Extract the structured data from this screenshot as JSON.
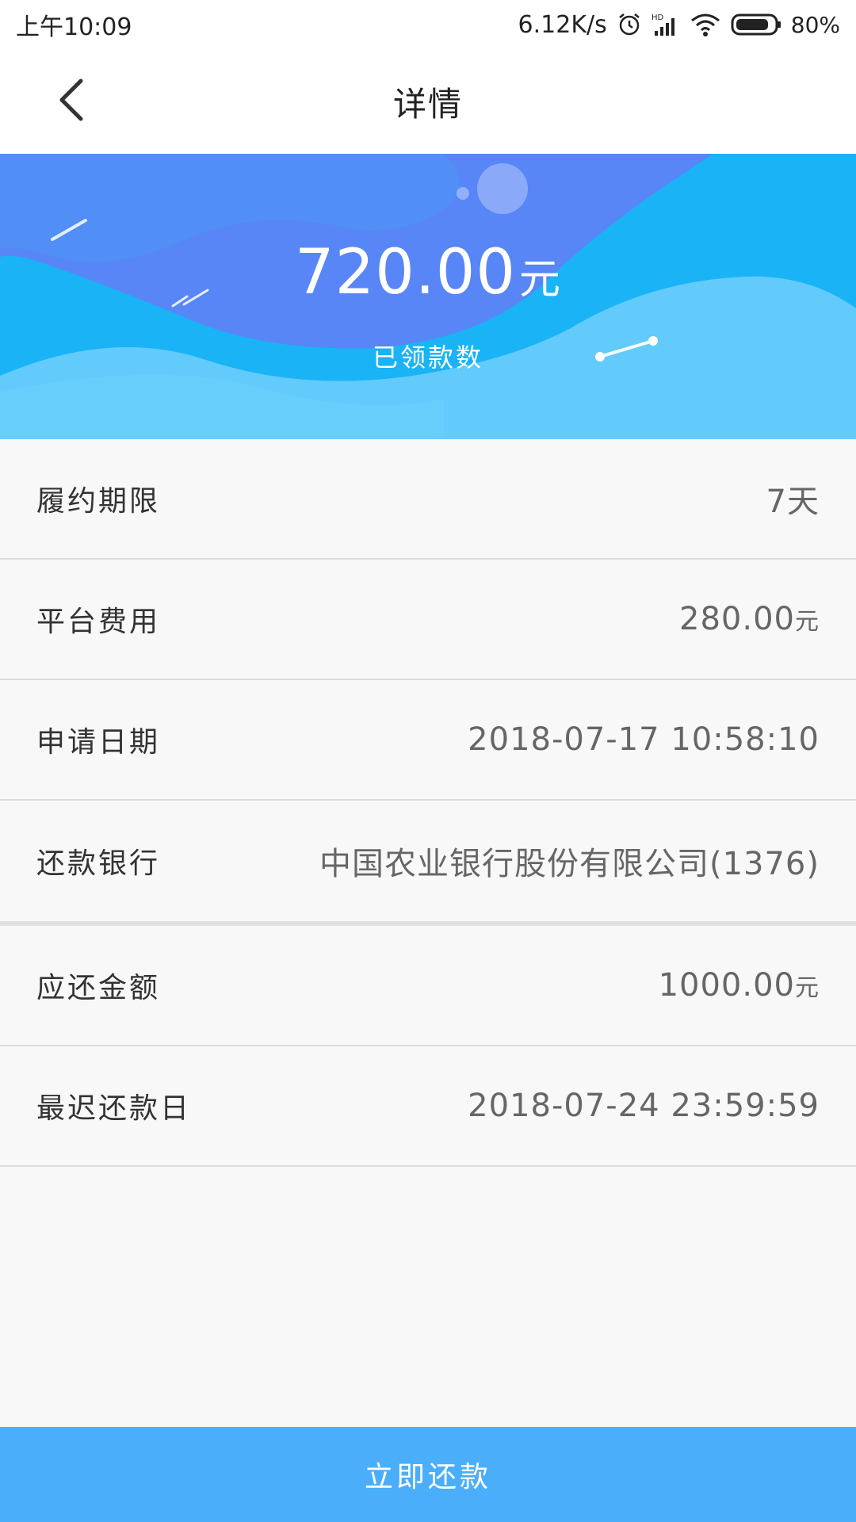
{
  "status_bar": {
    "time": "上午10:09",
    "net_speed": "6.12K/s",
    "battery": "80%",
    "icons": [
      "alarm-icon",
      "hd-signal-icon",
      "wifi-icon",
      "battery-icon"
    ]
  },
  "header": {
    "title": "详情",
    "back_icon": "chevron-left-icon"
  },
  "banner": {
    "amount": "720.00",
    "amount_unit": "元",
    "label": "已领款数",
    "colors": {
      "primary": "#1fb6f6",
      "secondary": "#5b86f7",
      "light": "#62cbfb"
    }
  },
  "details": {
    "term": {
      "label": "履约期限",
      "value": "7天"
    },
    "platform_fee": {
      "label": "平台费用",
      "value": "280.00",
      "unit": "元"
    },
    "apply_date": {
      "label": "申请日期",
      "value": "2018-07-17 10:58:10"
    },
    "repay_bank": {
      "label": "还款银行",
      "value": "中国农业银行股份有限公司(1376)"
    },
    "due_amount": {
      "label": "应还金额",
      "value": "1000.00",
      "unit": "元"
    },
    "latest_due_date": {
      "label": "最迟还款日",
      "value": "2018-07-24 23:59:59"
    }
  },
  "actions": {
    "repay_now": "立即还款",
    "button_color": "#4aaefb"
  }
}
